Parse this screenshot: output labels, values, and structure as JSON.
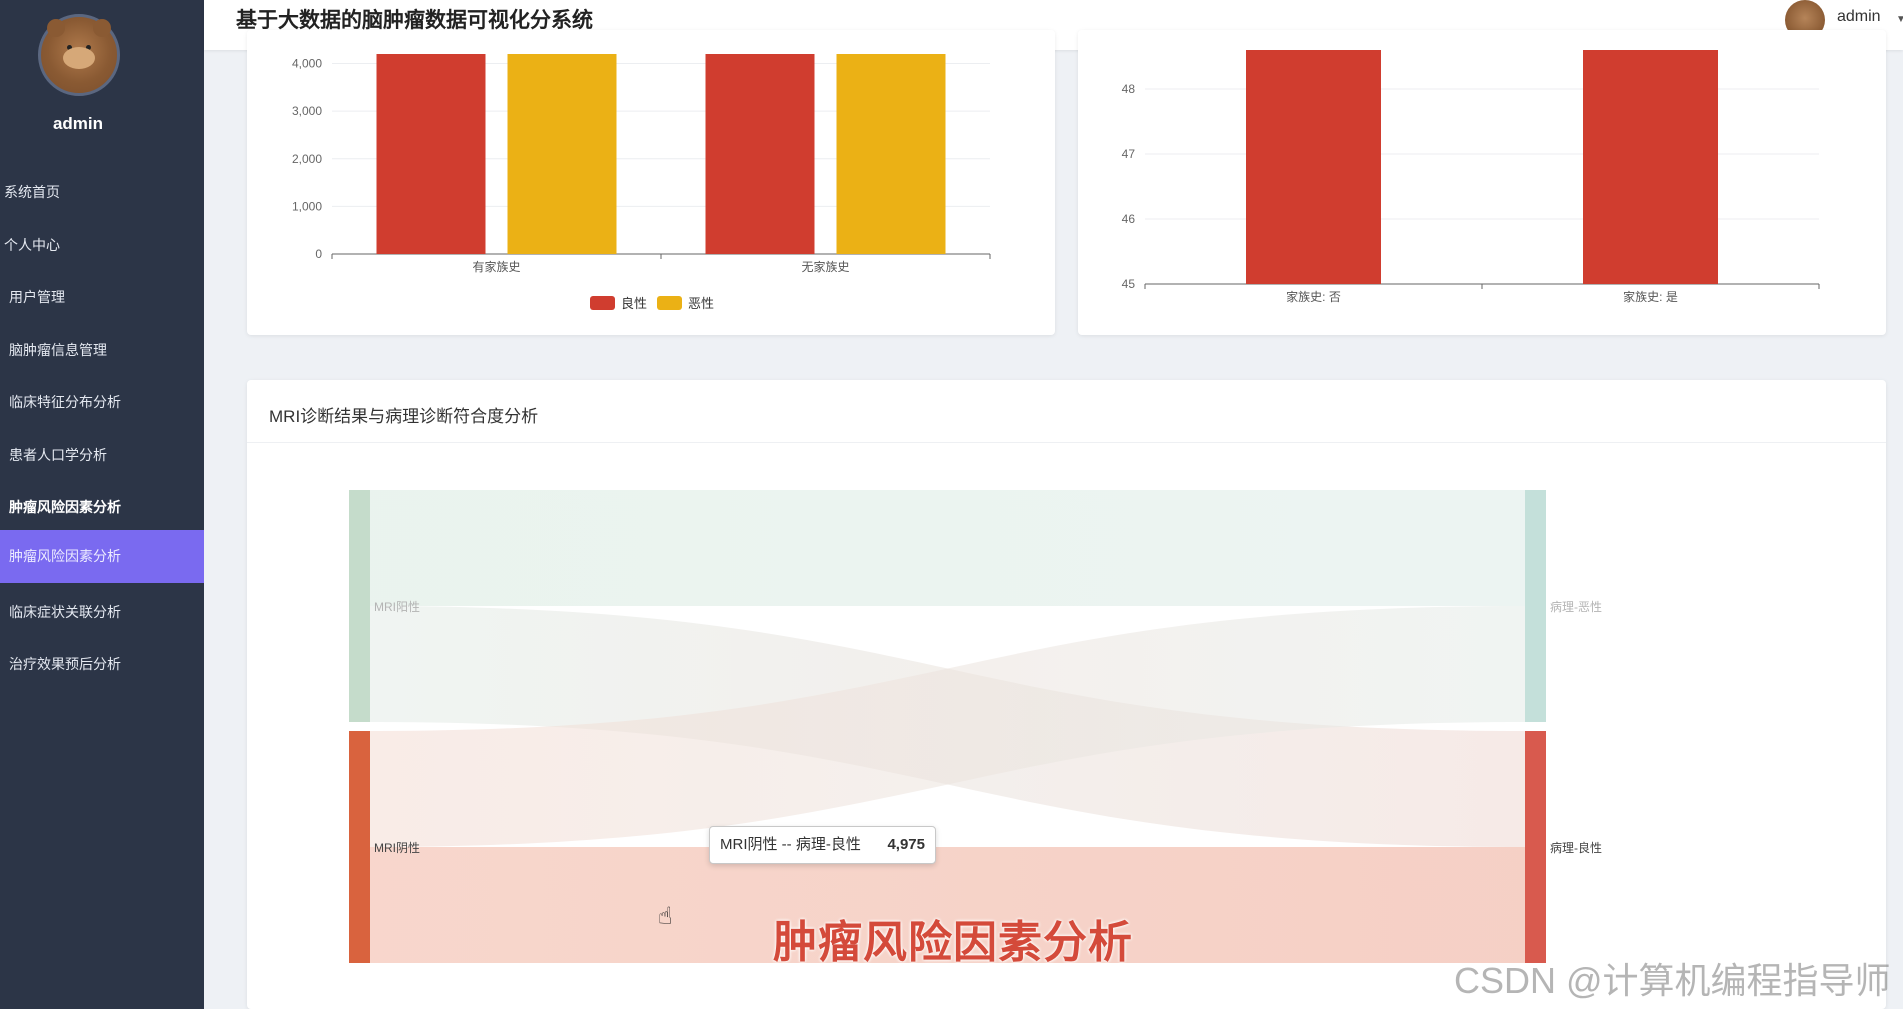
{
  "app": {
    "title": "基于大数据的脑肿瘤数据可视化分系统",
    "username": "admin"
  },
  "sidebar": {
    "username": "admin",
    "items": [
      {
        "label": "系统首页",
        "level": "top"
      },
      {
        "label": "个人中心",
        "level": "top"
      },
      {
        "label": "用户管理",
        "level": "sub"
      },
      {
        "label": "脑肿瘤信息管理",
        "level": "sub"
      },
      {
        "label": "临床特征分布分析",
        "level": "sub"
      },
      {
        "label": "患者人口学分析",
        "level": "sub"
      },
      {
        "label": "肿瘤风险因素分析",
        "level": "sub",
        "bold": true
      },
      {
        "label": "肿瘤风险因素分析",
        "level": "sub",
        "active": true
      },
      {
        "label": "临床症状关联分析",
        "level": "sub"
      },
      {
        "label": "治疗效果预后分析",
        "level": "sub"
      }
    ]
  },
  "chart_data": [
    {
      "type": "bar",
      "categories": [
        "有家族史",
        "无家族史"
      ],
      "series": [
        {
          "name": "良性",
          "color": "#d03d2f",
          "values": [
            4500,
            4500
          ]
        },
        {
          "name": "恶性",
          "color": "#ebb115",
          "values": [
            4500,
            4500
          ]
        }
      ],
      "ylim": [
        0,
        4200
      ],
      "yticks": [
        "0",
        "1,000",
        "2,000",
        "3,000",
        "4,000"
      ],
      "legend": "bottom-center"
    },
    {
      "type": "bar",
      "categories": [
        "家族史: 否",
        "家族史: 是"
      ],
      "values": [
        49,
        49
      ],
      "color": "#d03d2f",
      "ylim": [
        45,
        48.6
      ],
      "yticks": [
        "45",
        "46",
        "47",
        "48"
      ]
    },
    {
      "type": "sankey",
      "title": "MRI诊断结果与病理诊断符合度分析",
      "nodes": [
        {
          "name": "MRI阳性",
          "side": "left",
          "color": "#c5dccb"
        },
        {
          "name": "MRI阴性",
          "side": "left",
          "color": "#d9633e"
        },
        {
          "name": "病理-恶性",
          "side": "right",
          "color": "#c4e0da"
        },
        {
          "name": "病理-良性",
          "side": "right",
          "color": "#d85a4e"
        }
      ],
      "links": [
        {
          "source": "MRI阳性",
          "target": "病理-恶性"
        },
        {
          "source": "MRI阳性",
          "target": "病理-良性"
        },
        {
          "source": "MRI阴性",
          "target": "病理-恶性"
        },
        {
          "source": "MRI阴性",
          "target": "病理-良性",
          "value": 4975
        }
      ],
      "tooltip": {
        "label": "MRI阴性 -- 病理-良性",
        "value": "4,975"
      }
    }
  ],
  "overlay": {
    "caption": "肿瘤风险因素分析",
    "watermark": "CSDN @计算机编程指导师"
  }
}
